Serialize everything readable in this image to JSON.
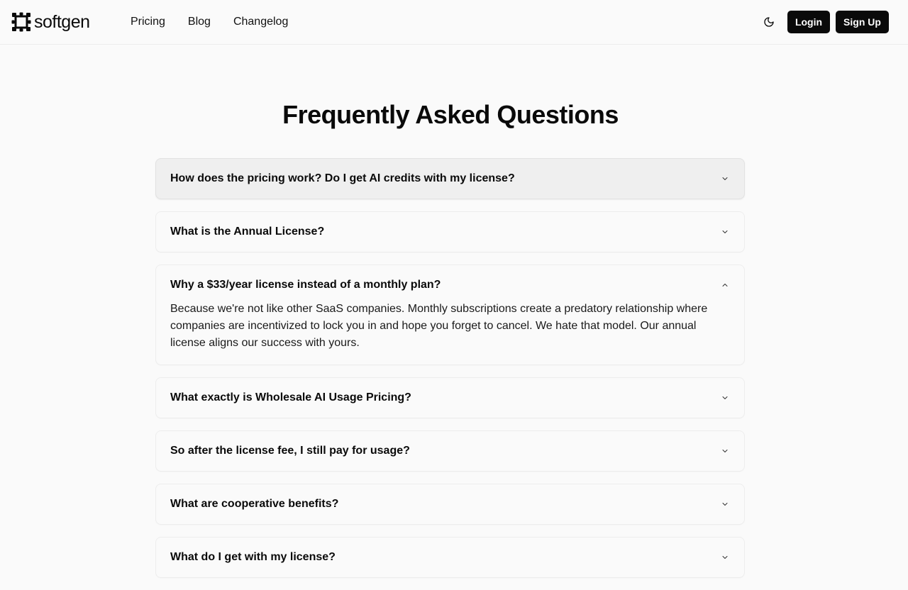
{
  "header": {
    "logo_text": "softgen",
    "nav": [
      "Pricing",
      "Blog",
      "Changelog"
    ],
    "theme_icon": "moon-icon",
    "login_label": "Login",
    "signup_label": "Sign Up"
  },
  "main": {
    "title": "Frequently Asked Questions",
    "faq": [
      {
        "question": "How does the pricing work? Do I get AI credits with my license?",
        "expanded": false
      },
      {
        "question": "What is the Annual License?",
        "expanded": false
      },
      {
        "question": "Why a $33/year license instead of a monthly plan?",
        "expanded": true,
        "answer": "Because we're not like other SaaS companies. Monthly subscriptions create a predatory relationship where companies are incentivized to lock you in and hope you forget to cancel. We hate that model. Our annual license aligns our success with yours."
      },
      {
        "question": "What exactly is Wholesale AI Usage Pricing?",
        "expanded": false
      },
      {
        "question": "So after the license fee, I still pay for usage?",
        "expanded": false
      },
      {
        "question": "What are cooperative benefits?",
        "expanded": false
      },
      {
        "question": "What do I get with my license?",
        "expanded": false
      }
    ]
  },
  "colors": {
    "text": "#0a0a0a",
    "background": "#fafafa",
    "button": "#0a0a0a",
    "button_text": "#ffffff",
    "hover_row": "#efefef"
  }
}
